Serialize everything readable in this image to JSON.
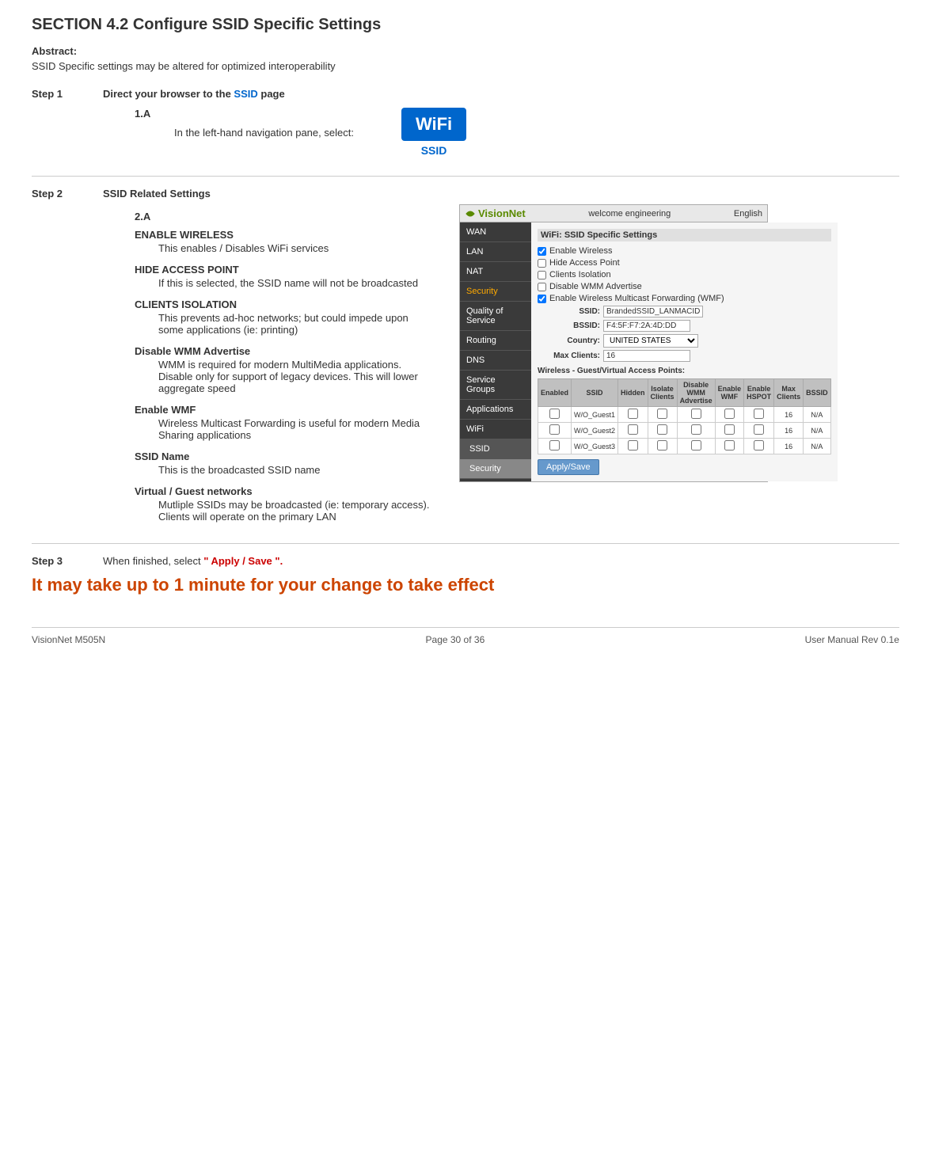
{
  "page": {
    "title": "SECTION 4.2 Configure SSID Specific Settings",
    "abstract_label": "Abstract:",
    "abstract_text": "SSID Specific settings may be altered for optimized interoperability",
    "step1": {
      "num": "Step 1",
      "title": "Direct your browser to the SSID  page",
      "sub_a_num": "1.A",
      "sub_a_text": "In the left-hand navigation pane, select:",
      "wifi_badge": "WiFi",
      "ssid_label": "SSID"
    },
    "step2": {
      "num": "Step 2",
      "title": "SSID Related Settings",
      "sub_num": "2.A",
      "items": [
        {
          "title": "ENABLE WIRELESS",
          "body": "This enables / Disables WiFi services"
        },
        {
          "title": "HIDE ACCESS POINT",
          "body": "If this is selected, the SSID name will not be broadcasted"
        },
        {
          "title": "CLIENTS ISOLATION",
          "body": "This prevents ad-hoc networks; but could impede upon some applications (ie: printing)"
        },
        {
          "title": "Disable WMM Advertise",
          "body": "WMM is required for modern MultiMedia applications. Disable only for support of legacy devices. This will lower aggregate speed"
        },
        {
          "title": "Enable WMF",
          "body": "Wireless Multicast Forwarding is useful for modern Media Sharing applications"
        },
        {
          "title": "SSID Name",
          "body": "This is the broadcasted SSID name"
        },
        {
          "title": "Virtual / Guest networks",
          "body": "Mutliple SSIDs may be broadcasted (ie: temporary access). Clients will operate on the primary LAN"
        }
      ]
    },
    "step3": {
      "num": "Step 3",
      "text_before": "When finished, select ",
      "highlight": "\" Apply / Save \".",
      "text_after": ""
    },
    "final_note": "It may take up to 1 minute for your change to take effect",
    "footer": {
      "left": "VisionNet   M505N",
      "center": "Page 30 of 36",
      "right": "User Manual Rev 0.1e"
    }
  },
  "router_ui": {
    "header_logo": "VisionNet",
    "header_subtitle": "welcome   engineering",
    "header_lang": "English",
    "nav_items": [
      {
        "label": "WAN",
        "active": false
      },
      {
        "label": "LAN",
        "active": false
      },
      {
        "label": "NAT",
        "active": false
      },
      {
        "label": "Security",
        "active": false,
        "highlight": true
      },
      {
        "label": "Quality of Service",
        "active": false
      },
      {
        "label": "Routing",
        "active": false
      },
      {
        "label": "DNS",
        "active": false
      },
      {
        "label": "Service Groups",
        "active": false
      },
      {
        "label": "Applications",
        "active": false
      },
      {
        "label": "WiFi",
        "active": false
      },
      {
        "label": "SSID",
        "active": true,
        "sub": true
      },
      {
        "label": "Security",
        "active": false,
        "sub": true
      }
    ],
    "main_title": "WiFi: SSID Specific Settings",
    "checkboxes": [
      {
        "label": "Enable Wireless",
        "checked": true
      },
      {
        "label": "Hide Access Point",
        "checked": false
      },
      {
        "label": "Clients Isolation",
        "checked": false
      },
      {
        "label": "Disable WMM Advertise",
        "checked": false
      },
      {
        "label": "Enable Wireless Multicast Forwarding (WMF)",
        "checked": true
      }
    ],
    "fields": [
      {
        "label": "SSID:",
        "value": "BrandedSSID_LANMACID"
      },
      {
        "label": "BSSID:",
        "value": "F4:5F:F7:2A:4D:DD"
      },
      {
        "label": "Country:",
        "value": "UNITED STATES",
        "type": "select"
      },
      {
        "label": "Max Clients:",
        "value": "16"
      }
    ],
    "guest_section_title": "Wireless - Guest/Virtual Access Points:",
    "guest_table_headers": [
      "Enabled",
      "SSID",
      "Hidden",
      "Isolate Clients",
      "Disable WMM Advertise",
      "Enable WMF",
      "Enable HSPOT",
      "Max Clients",
      "BSSID"
    ],
    "guest_rows": [
      {
        "ssid": "W/O_Guest1",
        "max_clients": "16",
        "bssid": "N/A"
      },
      {
        "ssid": "W/O_Guest2",
        "max_clients": "16",
        "bssid": "N/A"
      },
      {
        "ssid": "W/O_Guest3",
        "max_clients": "16",
        "bssid": "N/A"
      }
    ],
    "apply_btn": "Apply/Save"
  }
}
